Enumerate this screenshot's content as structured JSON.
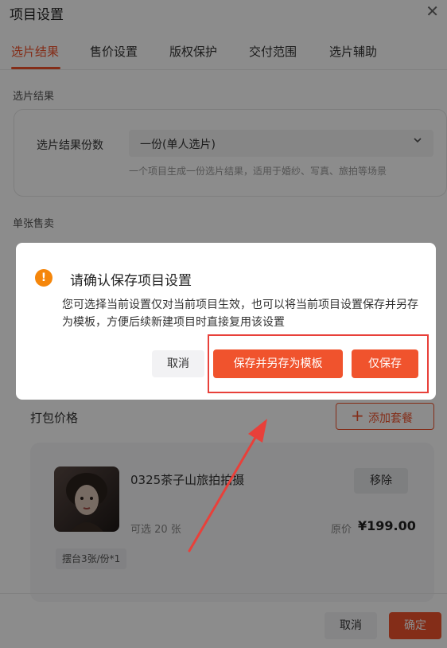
{
  "panel": {
    "title": "项目设置",
    "close_icon": "close-icon"
  },
  "tabs": [
    {
      "label": "选片结果",
      "active": true
    },
    {
      "label": "售价设置",
      "active": false
    },
    {
      "label": "版权保护",
      "active": false
    },
    {
      "label": "交付范围",
      "active": false
    },
    {
      "label": "选片辅助",
      "active": false
    }
  ],
  "selection_result": {
    "section_title": "选片结果",
    "field_label": "选片结果份数",
    "select_value": "一份(单人选片)",
    "hint": "一个项目生成一份选片结果，适用于婚纱、写真、旅拍等场景"
  },
  "single_sale": {
    "section_title": "单张售卖"
  },
  "package_price": {
    "label": "打包价格",
    "add_button": "添加套餐",
    "package": {
      "name": "0325茶子山旅拍拍摄",
      "remove_button": "移除",
      "count_text": "可选 20 张",
      "orig_label": "原价",
      "price": "¥199.00",
      "tag": "摆台3张/份*1"
    }
  },
  "footer": {
    "cancel": "取消",
    "ok": "确定"
  },
  "dialog": {
    "icon": "warning-icon",
    "title": "请确认保存项目设置",
    "message": "您可选择当前设置仅对当前项目生效，也可以将当前项目设置保存并另存为模板，方便后续新建项目时直接复用该设置",
    "cancel": "取消",
    "save_as_template": "保存并另存为模板",
    "save_only": "仅保存"
  },
  "colors": {
    "accent": "#f0532d",
    "warning": "#f5860b",
    "annotation": "#e8403a"
  }
}
